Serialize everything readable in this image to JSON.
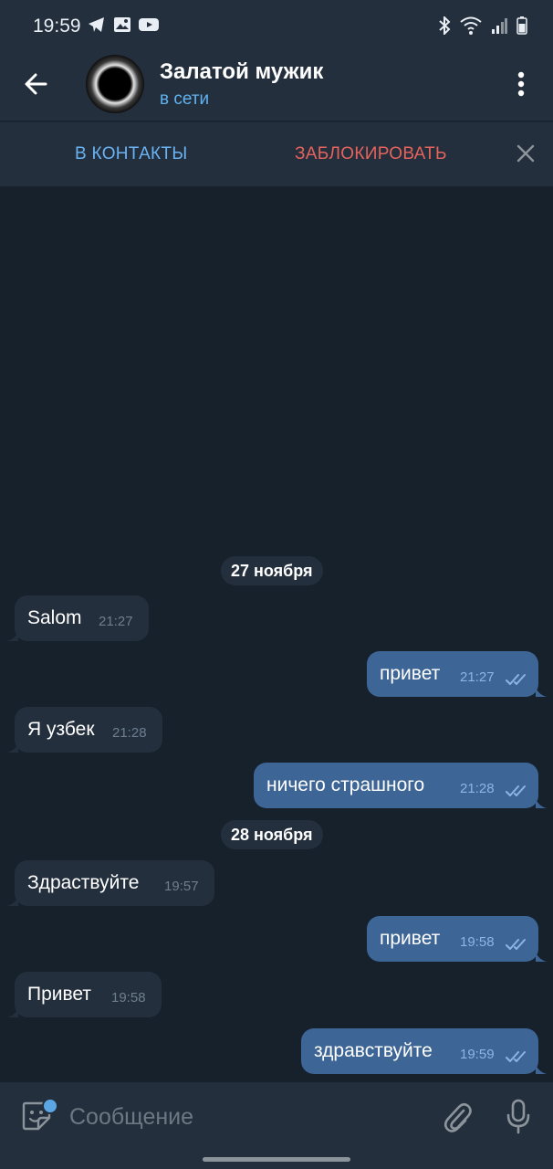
{
  "status_bar": {
    "time": "19:59"
  },
  "header": {
    "title": "Залатой мужик",
    "status": "в сети"
  },
  "action_bar": {
    "add_contact": "В КОНТАКТЫ",
    "block": "ЗАБЛОКИРОВАТЬ"
  },
  "chat": {
    "date_1": "27 ноября",
    "date_2": "28 ноября",
    "messages": [
      {
        "direction": "incoming",
        "text": "Salom",
        "time": "21:27"
      },
      {
        "direction": "outgoing",
        "text": "привет",
        "time": "21:27",
        "read": true
      },
      {
        "direction": "incoming",
        "text": "Я узбек",
        "time": "21:28"
      },
      {
        "direction": "outgoing",
        "text": "ничего страшного",
        "time": "21:28",
        "read": true
      },
      {
        "direction": "incoming",
        "text": "Здраствуйте",
        "time": "19:57"
      },
      {
        "direction": "outgoing",
        "text": "привет",
        "time": "19:58",
        "read": true
      },
      {
        "direction": "incoming",
        "text": "Привет",
        "time": "19:58"
      },
      {
        "direction": "outgoing",
        "text": "здравствуйте",
        "time": "19:59",
        "read": true
      }
    ]
  },
  "input": {
    "placeholder": "Сообщение"
  },
  "colors": {
    "background": "#17212b",
    "header": "#242f3d",
    "incoming_bubble": "#242f3d",
    "outgoing_bubble": "#3d6596",
    "online": "#5fb3f0",
    "block": "#e5635c",
    "accent": "#6ab3f3"
  }
}
